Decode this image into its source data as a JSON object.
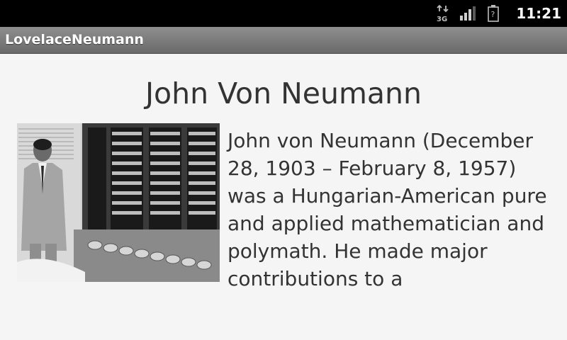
{
  "status_bar": {
    "network_icon": "3g-data-icon",
    "signal_icon": "signal-strength-icon",
    "battery_icon": "battery-unknown-icon",
    "time": "11:21"
  },
  "app": {
    "title": "LovelaceNeumann"
  },
  "main": {
    "heading": "John Von Neumann",
    "photo_icon": "photo-von-neumann-with-computer",
    "bio": "John von Neumann (December 28, 1903 – February 8, 1957) was a Hungarian-American pure and applied mathematician and polymath. He made major contributions to a"
  },
  "colors": {
    "status_bar_bg": "#000000",
    "title_bar_bg": "#7a7a7a",
    "content_bg": "#f5f5f5",
    "text": "#333333"
  }
}
